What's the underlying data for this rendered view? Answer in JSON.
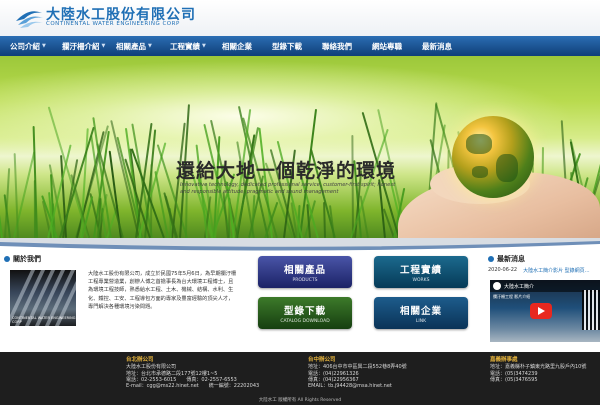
{
  "brand": {
    "name_cn": "大陸水工股份有限公司",
    "name_en": "CONTINENTAL WATER ENGINEERING CORP",
    "accent_color": "#1f6fb5"
  },
  "nav": {
    "items": [
      {
        "label": "公司介紹",
        "has_dropdown": true
      },
      {
        "label": "攔汙柵介紹",
        "has_dropdown": true
      },
      {
        "label": "相關產品",
        "has_dropdown": true
      },
      {
        "label": "工程實績",
        "has_dropdown": true
      },
      {
        "label": "相關企業",
        "has_dropdown": false
      },
      {
        "label": "型錄下載",
        "has_dropdown": false
      },
      {
        "label": "聯絡我們",
        "has_dropdown": false
      },
      {
        "label": "網站專職",
        "has_dropdown": false
      },
      {
        "label": "最新消息",
        "has_dropdown": false
      }
    ],
    "caret_glyph": "▼"
  },
  "hero": {
    "title": "還給大地一個乾淨的環境",
    "subtitle": "Innovative technology, dedicated professional service, customer-first spirit; honest and responsible attitude, pragmatic and sound management",
    "slide_count": 3,
    "active_slide": 2
  },
  "about": {
    "heading": "關於我們",
    "image_caption": "CONTINENTAL WATER ENGINEERING CORP",
    "text": "大陸水工股份有限公司，成立於民國75年5月6日，為早期攔汙柵工程專業營造業，創辦人博之首擔事長為台大環境工程博士，且為環境工程技師，熟悉給水工程、土木、機械、結構、水利、生化、鐵控、工安、工程導包方面的專家及豐富經驗的頂尖人才，專門解決各種環境污染問題。"
  },
  "tiles": {
    "products": {
      "cn": "相關產品",
      "en": "PRODUCTS"
    },
    "works": {
      "cn": "工程實績",
      "en": "WORKS"
    },
    "catalog": {
      "cn": "型錄下載",
      "en": "CATALOG DOWNLOAD"
    },
    "link": {
      "cn": "相關企業",
      "en": "LINK"
    }
  },
  "news": {
    "heading": "最新消息",
    "items": [
      {
        "date": "2020-06-22",
        "title": "大陸水工簡介影片 型錄網頁…"
      }
    ],
    "video": {
      "title": "大陸水工簡介",
      "caption": "攔汙柵工程 影片介紹"
    }
  },
  "footer": {
    "col1": {
      "title": "台北辦公司",
      "lines": [
        "大陸水工股份有限公司",
        "地址：台北市承德路二段177號12樓1~5",
        "電話：02-2553-6015　　傳真：02-2557-6553",
        "E-mail：cgg@ms22.hinet.net　　統一編號：22202043"
      ]
    },
    "col2": {
      "title": "台中辦公司",
      "lines": [
        "地址：406台中市中區興二段552巷8弄40號",
        "電話：(04)22961326",
        "傳真：(04)22956367",
        "EMAIL：tb.j94428@msa.hinet.net"
      ]
    },
    "col3": {
      "title": "嘉義辦事處",
      "lines": [
        "地址：嘉義縣朴子鎮東光路里九股戶內10號",
        "電話：(05)3474239",
        "傳真：(05)3476595"
      ]
    },
    "copyright": "大陸水工 版權所有 All Rights Reserved"
  }
}
